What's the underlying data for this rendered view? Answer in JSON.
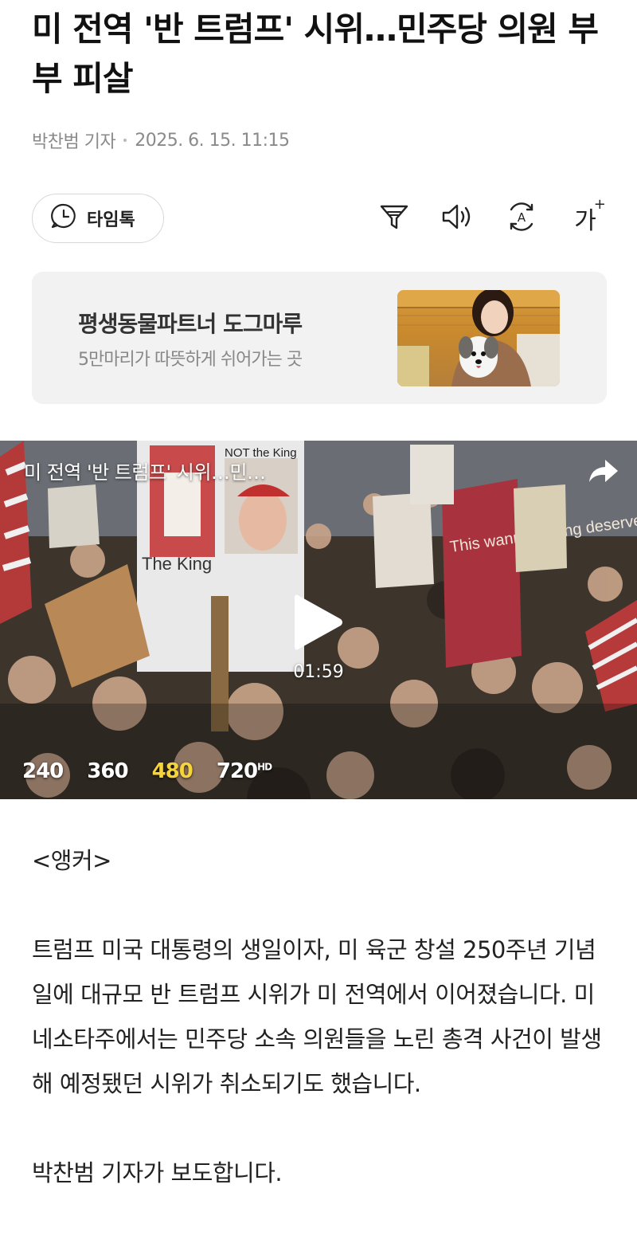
{
  "article": {
    "headline": "미 전역 '반 트럼프' 시위…민주당 의원 부부 피살",
    "reporter": "박찬범 기자",
    "datetime": "2025. 6. 15. 11:15"
  },
  "toolbar": {
    "timetalk_label": "타임톡",
    "fontsize_label": "가"
  },
  "ad": {
    "title": "평생동물파트너 도그마루",
    "subtitle": "5만마리가 따뜻하게 쉬어가는 곳"
  },
  "video": {
    "title": "미 전역 '반 트럼프' 시위…민…",
    "duration": "01:59",
    "qualities": [
      "240",
      "360",
      "480",
      "720"
    ],
    "selected_quality": "480",
    "hd_badge": "HD",
    "image_signs": [
      "NOT the King",
      "The King",
      "This wannabe king deserves a ROYAL FLUSH"
    ]
  },
  "body": {
    "anchor": "<앵커>",
    "paragraph": "트럼프 미국 대통령의 생일이자, 미 육군 창설 250주년 기념일에 대규모 반 트럼프 시위가 미 전역에서 이어졌습니다. 미네소타주에서는 민주당 소속 의원들을 노린 총격 사건이 발생해 예정됐던 시위가 취소되기도 했습니다.",
    "closing": "박찬범 기자가 보도합니다."
  },
  "colors": {
    "selected_quality": "#f5d33a",
    "meta_text": "#8a8a8a",
    "ad_background": "#f2f2f2"
  }
}
